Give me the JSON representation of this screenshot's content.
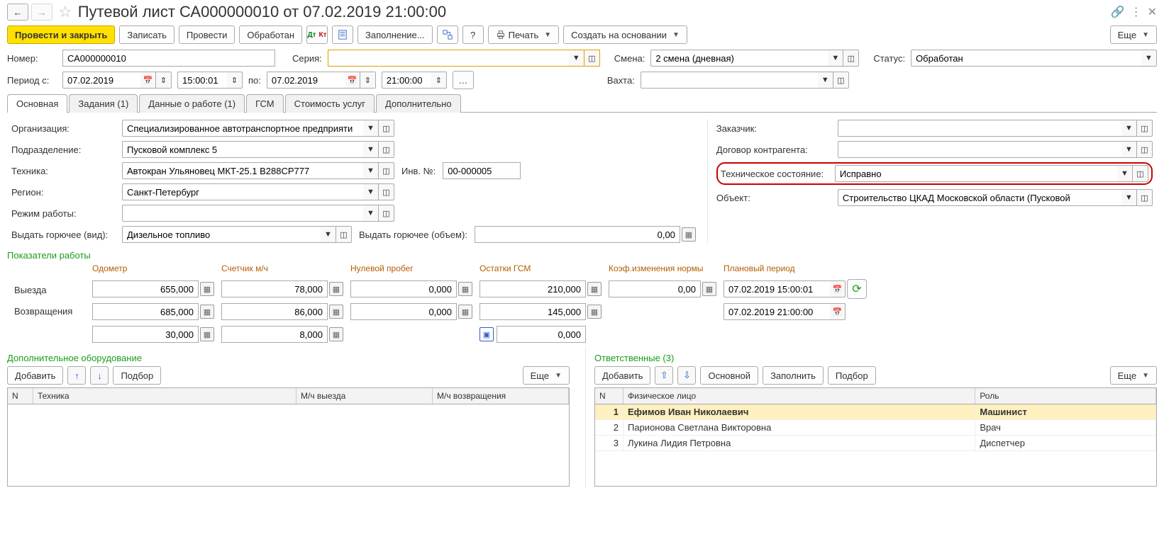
{
  "header": {
    "title": "Путевой лист СА000000010 от 07.02.2019 21:00:00"
  },
  "toolbar": {
    "post_close": "Провести и закрыть",
    "save": "Записать",
    "post": "Провести",
    "processed": "Обработан",
    "fill": "Заполнение...",
    "print": "Печать",
    "create_based": "Создать на основании",
    "more": "Еще"
  },
  "fields": {
    "number_label": "Номер:",
    "number": "СА000000010",
    "series_label": "Серия:",
    "series": "",
    "shift_label": "Смена:",
    "shift": "2 смена (дневная)",
    "status_label": "Статус:",
    "status": "Обработан",
    "period_from_label": "Период с:",
    "date_from": "07.02.2019",
    "time_from": "15:00:01",
    "to_label": "по:",
    "date_to": "07.02.2019",
    "time_to": "21:00:00",
    "rotation_label": "Вахта:",
    "rotation": ""
  },
  "tabs": {
    "main": "Основная",
    "tasks": "Задания (1)",
    "work_data": "Данные о работе (1)",
    "fuel": "ГСМ",
    "cost": "Стоимость услуг",
    "addl": "Дополнительно"
  },
  "main": {
    "org_label": "Организация:",
    "org": "Специализированное автотранспортное предприяти",
    "dept_label": "Подразделение:",
    "dept": "Пусковой комплекс 5",
    "tech_label": "Техника:",
    "tech": "Автокран Ульяновец МКТ-25.1 В288СР777",
    "invno_label": "Инв. №:",
    "invno": "00-000005",
    "region_label": "Регион:",
    "region": "Санкт-Петербург",
    "mode_label": "Режим работы:",
    "mode": "",
    "fueltype_label": "Выдать горючее (вид):",
    "fueltype": "Дизельное топливо",
    "fuelvol_label": "Выдать горючее (объем):",
    "fuelvol": "0,00",
    "customer_label": "Заказчик:",
    "customer": "",
    "contract_label": "Договор контрагента:",
    "contract": "",
    "techstate_label": "Техническое состояние:",
    "techstate": "Исправно",
    "object_label": "Объект:",
    "object": "Строительство ЦКАД Московской области (Пусковой"
  },
  "metrics": {
    "section": "Показатели работы",
    "row_departure": "Выезда",
    "row_return": "Возвращения",
    "odometer_head": "Одометр",
    "odometer_out": "655,000",
    "odometer_in": "685,000",
    "odometer_diff": "30,000",
    "mh_head": "Счетчик м/ч",
    "mh_out": "78,000",
    "mh_in": "86,000",
    "mh_diff": "8,000",
    "zero_head": "Нулевой пробег",
    "zero_out": "0,000",
    "zero_in": "0,000",
    "fuelrem_head": "Остатки ГСМ",
    "fuelrem_out": "210,000",
    "fuelrem_in": "145,000",
    "fuelrem_diff": "0,000",
    "coef_head": "Коэф.изменения нормы",
    "coef": "0,00",
    "plan_head": "Плановый период",
    "plan_from": "07.02.2019 15:00:01",
    "plan_to": "07.02.2019 21:00:00"
  },
  "equip": {
    "section": "Дополнительное оборудование",
    "add": "Добавить",
    "pick": "Подбор",
    "more": "Еще",
    "col_n": "N",
    "col_tech": "Техника",
    "col_mh_out": "М/ч выезда",
    "col_mh_in": "М/ч возвращения"
  },
  "resp": {
    "section": "Ответственные (3)",
    "add": "Добавить",
    "main_btn": "Основной",
    "fill": "Заполнить",
    "pick": "Подбор",
    "more": "Еще",
    "col_n": "N",
    "col_person": "Физическое лицо",
    "col_role": "Роль",
    "rows": [
      {
        "n": "1",
        "person": "Ефимов Иван Николаевич",
        "role": "Машинист",
        "selected": true,
        "bold": true
      },
      {
        "n": "2",
        "person": "Парионова Светлана Викторовна",
        "role": "Врач"
      },
      {
        "n": "3",
        "person": "Лукина Лидия Петровна",
        "role": "Диспетчер"
      }
    ]
  }
}
